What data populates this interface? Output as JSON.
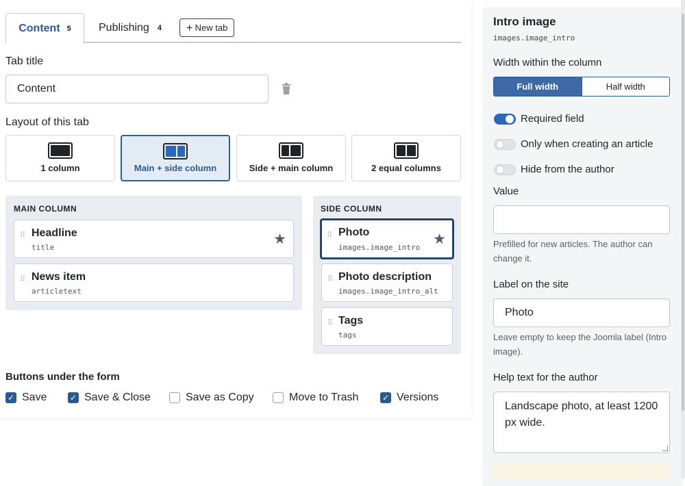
{
  "tabs": [
    {
      "label": "Content",
      "count": "5"
    },
    {
      "label": "Publishing",
      "count": "4"
    }
  ],
  "new_tab_label": "New tab",
  "tab_title_label": "Tab title",
  "tab_title_value": "Content",
  "layout_label": "Layout of this tab",
  "layouts": [
    "1 column",
    "Main + side column",
    "Side + main column",
    "2 equal columns"
  ],
  "selected_layout": "Main + side column",
  "main_column": {
    "heading": "MAIN COLUMN",
    "fields": [
      {
        "name": "Headline",
        "code": "title",
        "starred": true
      },
      {
        "name": "News item",
        "code": "articletext",
        "starred": false
      }
    ]
  },
  "side_column": {
    "heading": "SIDE COLUMN",
    "fields": [
      {
        "name": "Photo",
        "code": "images.image_intro",
        "starred": true,
        "selected": true
      },
      {
        "name": "Photo description",
        "code": "images.image_intro_alt",
        "starred": false
      },
      {
        "name": "Tags",
        "code": "tags",
        "starred": false
      }
    ]
  },
  "buttons_heading": "Buttons under the form",
  "buttons": [
    {
      "label": "Save",
      "checked": true
    },
    {
      "label": "Save & Close",
      "checked": true
    },
    {
      "label": "Save as Copy",
      "checked": false
    },
    {
      "label": "Move to Trash",
      "checked": false
    },
    {
      "label": "Versions",
      "checked": true
    }
  ],
  "panel": {
    "title": "Intro image",
    "code": "images.image_intro",
    "width_label": "Width within the column",
    "width_options": [
      "Full width",
      "Half width"
    ],
    "width_selected": "Full width",
    "toggles": [
      {
        "label": "Required field",
        "on": true
      },
      {
        "label": "Only when creating an article",
        "on": false
      },
      {
        "label": "Hide from the author",
        "on": false
      }
    ],
    "value_label": "Value",
    "value_input": "",
    "value_help": "Prefilled for new articles. The author can change it.",
    "site_label": "Label on the site",
    "site_label_value": "Photo",
    "site_label_help": "Leave empty to keep the Joomla label (Intro image).",
    "help_label": "Help text for the author",
    "help_value": "Landscape photo, at least 1200 px wide."
  },
  "colors": {
    "accent": "#2a5a94",
    "selected_bg": "#e3ebf5",
    "panel_bg": "#f4f5f7"
  }
}
